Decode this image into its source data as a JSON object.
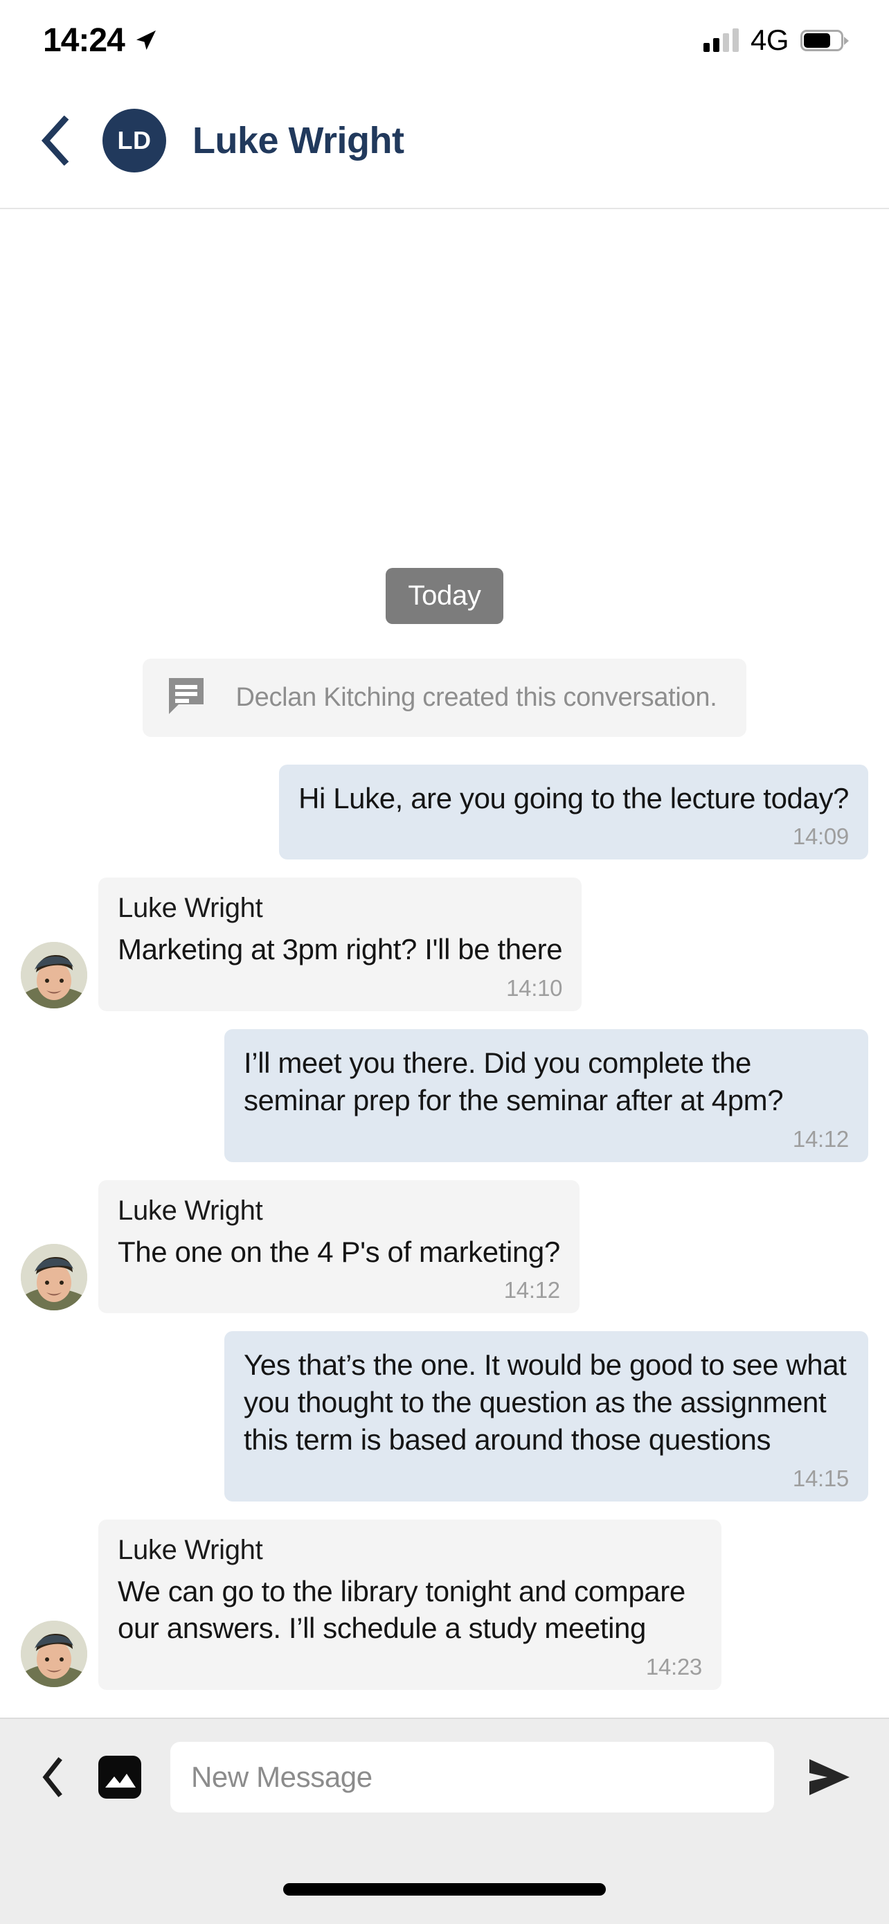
{
  "status_bar": {
    "time": "14:24",
    "location_icon": "location-arrow-icon",
    "signal_icon": "cellular-signal-icon",
    "network": "4G",
    "battery_icon": "battery-icon"
  },
  "header": {
    "back_icon": "back-chevron-icon",
    "avatar_initials": "LD",
    "title": "Luke Wright",
    "accent_color": "#21395c"
  },
  "chat": {
    "day_divider": "Today",
    "system_message": {
      "icon": "conversation-bubble-icon",
      "text": "Declan Kitching created this conversation."
    },
    "messages": [
      {
        "direction": "out",
        "text": "Hi Luke, are you going to the lecture today?",
        "time": "14:09"
      },
      {
        "direction": "in",
        "sender": "Luke Wright",
        "text": "Marketing at 3pm right? I'll be there",
        "time": "14:10",
        "avatar": "luke-wright-avatar"
      },
      {
        "direction": "out",
        "text": "I’ll meet you there. Did you complete the seminar prep for the seminar after at 4pm?",
        "time": "14:12"
      },
      {
        "direction": "in",
        "sender": "Luke Wright",
        "text": "The one on the 4 P's of marketing?",
        "time": "14:12",
        "avatar": "luke-wright-avatar"
      },
      {
        "direction": "out",
        "text": "Yes that’s the one. It would be good to see what you thought to the question as the assignment this term is based around those questions",
        "time": "14:15"
      },
      {
        "direction": "in",
        "sender": "Luke Wright",
        "text": "We can go to the library tonight and compare our answers. I’ll schedule a study meeting",
        "time": "14:23",
        "avatar": "luke-wright-avatar"
      }
    ]
  },
  "composer": {
    "back_icon": "back-chevron-icon",
    "image_icon": "image-attachment-icon",
    "input_placeholder": "New Message",
    "input_value": "",
    "send_icon": "send-arrow-icon"
  },
  "colors": {
    "outgoing_bubble": "#e0e8f1",
    "incoming_bubble": "#f4f4f4",
    "system_bubble": "#f4f4f4",
    "day_pill": "#7c7c7c",
    "composer_bg": "#ededed"
  }
}
